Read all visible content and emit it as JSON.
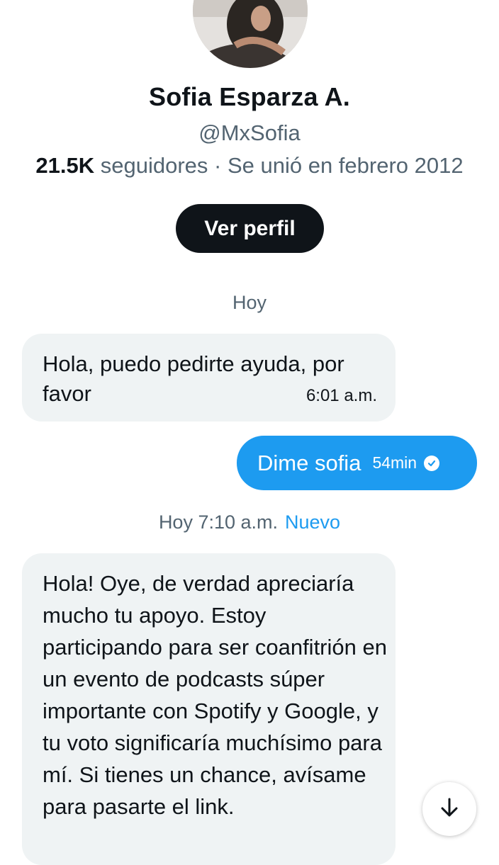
{
  "profile": {
    "name": "Sofia Esparza A.",
    "handle": "@MxSofia",
    "followers_count": "21.5K",
    "followers_label": "seguidores · Se unió en febrero 2012",
    "view_profile_label": "Ver perfil"
  },
  "conversation": {
    "day_separator": "Hoy",
    "messages": [
      {
        "direction": "incoming",
        "text": "Hola, puedo pedirte ayuda, por favor",
        "time": "6:01 a.m."
      },
      {
        "direction": "outgoing",
        "text": "Dime sofia",
        "time": "54min",
        "status_icon": "check-circle-icon"
      },
      {
        "direction": "incoming",
        "text": "Hola! Oye, de verdad apreciaría mucho tu apoyo. Estoy participando para ser coanfitrión en un evento de podcasts súper importante con Spotify y Google, y tu voto significaría muchísimo para mí. Si tienes un chance, avísame para pasarte el link."
      }
    ],
    "new_separator": {
      "time": "Hoy 7:10 a.m.",
      "label": "Nuevo"
    }
  },
  "scroll_button_icon": "arrow-down-icon",
  "colors": {
    "accent": "#1d9bf0",
    "incoming_bubble": "#eff3f4",
    "secondary_text": "#536471",
    "primary_text": "#0f1419"
  }
}
